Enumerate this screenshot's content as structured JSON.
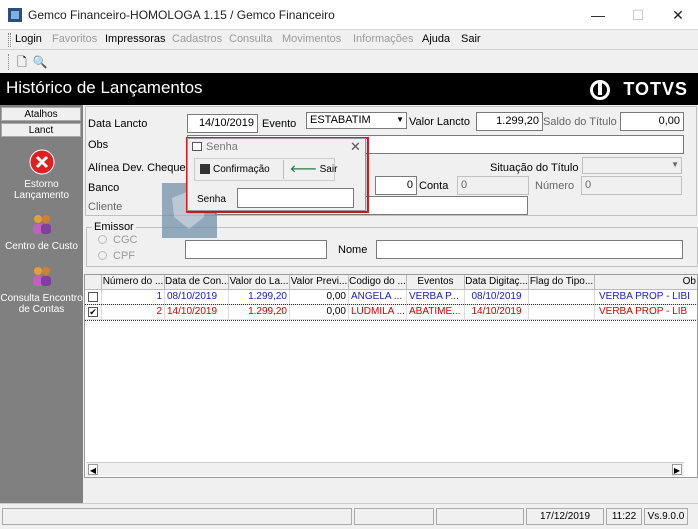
{
  "window": {
    "title": "Gemco Financeiro-HOMOLOGA 1.15 / Gemco Financeiro",
    "minimize": "—",
    "maximize": "☐",
    "close": "✕"
  },
  "menu": [
    {
      "label": "Login",
      "enabled": true
    },
    {
      "label": "Favoritos",
      "enabled": false
    },
    {
      "label": "Impressoras",
      "enabled": true
    },
    {
      "label": "Cadastros",
      "enabled": false
    },
    {
      "label": "Consulta",
      "enabled": false
    },
    {
      "label": "Movimentos",
      "enabled": false
    },
    {
      "label": "Informações",
      "enabled": false
    },
    {
      "label": "Ajuda",
      "enabled": true
    },
    {
      "label": "Sair",
      "enabled": true
    }
  ],
  "header": {
    "title": "Histórico de Lançamentos",
    "brand": "TOTVS"
  },
  "sidebar": {
    "tabs": [
      "Atalhos",
      "Lanct"
    ],
    "items": [
      {
        "label": "Estorno Lançamento",
        "icon": "cancel-icon"
      },
      {
        "label": "Centro de Custo",
        "icon": "people-icon"
      },
      {
        "label": "Consulta Encontro de Contas",
        "icon": "people-icon"
      }
    ]
  },
  "form": {
    "data_lancto_label": "Data Lancto",
    "data_lancto_value": "14/10/2019",
    "evento_label": "Evento",
    "evento_value": "ESTABATIM",
    "valor_label": "Valor Lancto",
    "valor_value": "1.299,20",
    "saldo_label": "Saldo do Título",
    "saldo_value": "0,00",
    "obs_label": "Obs",
    "alinea_label": "Alínea Dev. Cheque",
    "situacao_label": "Situação do Título",
    "banco_label": "Banco",
    "banco_zero": "0",
    "conta_label": "Conta",
    "conta_value": "0",
    "numero_label": "Número",
    "numero_value": "0",
    "cliente_label": "Cliente",
    "emissor_label": "Emissor",
    "cgc_label": "CGC",
    "cpf_label": "CPF",
    "nome_label": "Nome"
  },
  "dialog": {
    "title": "Senha",
    "confirm_label": "Confirmação",
    "exit_label": "Sair",
    "senha_label": "Senha",
    "senha_value": ""
  },
  "grid": {
    "columns": [
      "Número do ...",
      "Data de Con...",
      "Valor do La...",
      "Valor Previ...",
      "Codigo do ...",
      "Eventos",
      "Data Digitaç...",
      "Flag do Tipo...",
      "Ob"
    ],
    "rows": [
      {
        "checked": false,
        "color": "blue",
        "cells": [
          "1",
          "08/10/2019",
          "1.299,20",
          "0,00",
          "ANGELA ...",
          "VERBA P...",
          "08/10/2019",
          "",
          "VERBA PROP - LIBI"
        ]
      },
      {
        "checked": true,
        "color": "red",
        "cells": [
          "2",
          "14/10/2019",
          "1.299,20",
          "0,00",
          "LUDMILA ...",
          "ABATIME...",
          "14/10/2019",
          "",
          "VERBA PROP - LIB"
        ]
      }
    ]
  },
  "status": {
    "date": "17/12/2019",
    "time": "11:22",
    "version": "Vs.9.0.0"
  }
}
